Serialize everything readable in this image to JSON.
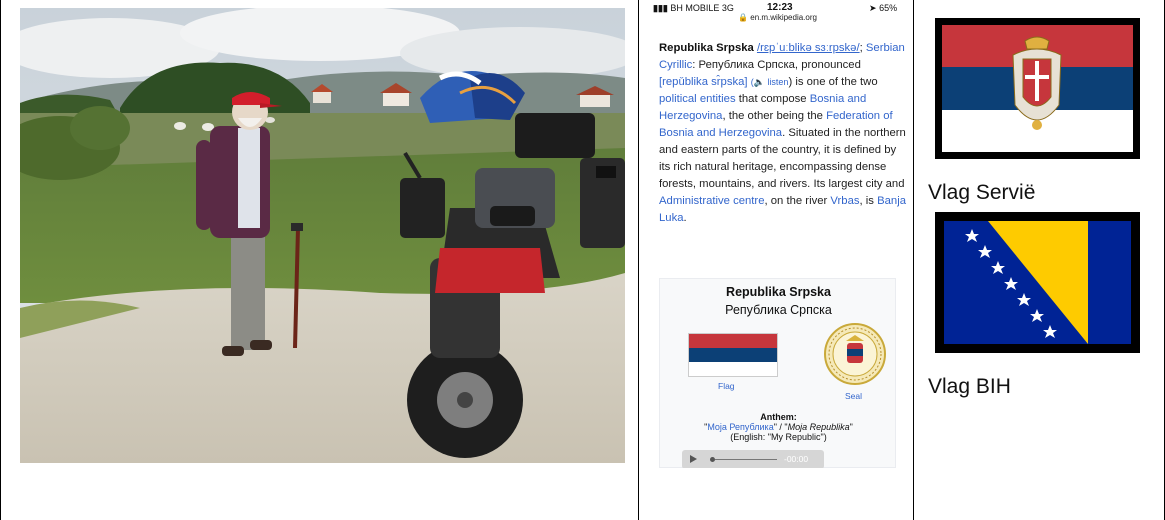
{
  "phone": {
    "carrier": "BH MOBILE  3G",
    "time": "12:23",
    "battery": "65%",
    "url": "en.m.wikipedia.org",
    "article": {
      "term": "Republika Srpska",
      "ipa": "/rɛpˈuːblikə sɜːrpskə/",
      "semicolon": ";",
      "cyrillic_link": "Serbian Cyrillic",
      "cyrillic_text": ": Република Српска,",
      "pronounced": "pronounced",
      "pron_link": "[repǔblika sr̂pska]",
      "listen": "listen",
      "is_one": ") is one",
      "line4": "of the two",
      "entities_link": "political entities",
      "compose": "that compose",
      "bih_link": "Bosnia and Herzegovina",
      "other": ", the other being the",
      "fed_link": "Federation of Bosnia and Herzegovina",
      "period": ".",
      "body": "Situated in the northern and eastern parts of the country, it is defined by its rich natural heritage, encompassing dense forests, mountains, and rivers. Its largest city and",
      "admin_link": "Administrative centre",
      "river": ", on the river",
      "vrbas_link": "Vrbas",
      "is": ", is",
      "banja_link": "Banja Luka",
      "end": "."
    },
    "infobox": {
      "title": "Republika Srpska",
      "subtitle": "Република Српска",
      "flag_caption": "Flag",
      "seal_caption": "Seal",
      "anthem_label": "Anthem:",
      "anthem_cyr": "Моја Република",
      "anthem_sep": "\" / \"",
      "anthem_lat": "Moja Republika",
      "anthem_en": "(English: \"My Republic\")",
      "audio_time": "-00:00"
    }
  },
  "flags": {
    "serbia_caption": "Vlag Servië",
    "bih_caption": "Vlag BIH"
  },
  "colors": {
    "link": "#3366cc",
    "serbia_red": "#c6363c",
    "serbia_blue": "#0c4076",
    "bih_blue": "#002395",
    "bih_yellow": "#fecb00"
  }
}
